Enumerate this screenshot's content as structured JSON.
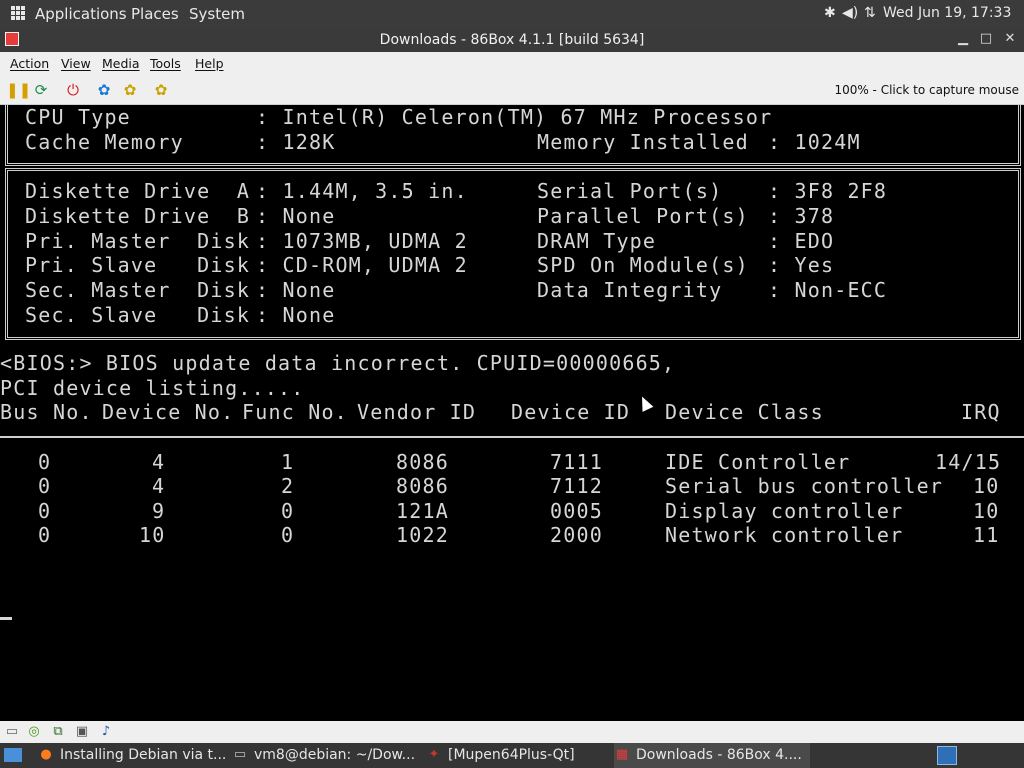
{
  "top_panel": {
    "menus": [
      "Applications",
      "Places",
      "System"
    ],
    "clock": "Wed Jun 19, 17:33",
    "tray_icons": [
      "bluetooth-icon",
      "volume-icon",
      "network-icon"
    ]
  },
  "window": {
    "title": "Downloads - 86Box 4.1.1 [build 5634]",
    "controls": [
      "minimize-icon",
      "maximize-icon",
      "close-icon"
    ]
  },
  "menubar": [
    "Action",
    "View",
    "Media",
    "Tools",
    "Help"
  ],
  "toolbar": {
    "icons": [
      "pause-icon",
      "reset-icon",
      "power-icon",
      "settings-icon",
      "ctrl-alt-del-icon",
      "hard-reset-icon"
    ],
    "capture_text": "100% - Click to capture mouse"
  },
  "bios": {
    "top_box": [
      {
        "left": "CPU Type",
        "left_val": ": Intel(R) Celeron(TM) 67 MHz Processor",
        "right": "",
        "right_val": ""
      },
      {
        "left": "Cache Memory",
        "left_val": ": 128K",
        "right": "Memory Installed",
        "right_val": ": 1024M"
      }
    ],
    "mid_box": [
      {
        "left": "Diskette Drive  A",
        "left_val": ": 1.44M, 3.5 in.",
        "right": "Serial Port(s)",
        "right_val": ": 3F8 2F8"
      },
      {
        "left": "Diskette Drive  B",
        "left_val": ": None",
        "right": "Parallel Port(s)",
        "right_val": ": 378"
      },
      {
        "left": "Pri. Master  Disk",
        "left_val": ": 1073MB, UDMA 2",
        "right": "DRAM Type",
        "right_val": ": EDO"
      },
      {
        "left": "Pri. Slave   Disk",
        "left_val": ": CD-ROM, UDMA 2",
        "right": "SPD On Module(s)",
        "right_val": ": Yes"
      },
      {
        "left": "Sec. Master  Disk",
        "left_val": ": None",
        "right": "Data Integrity",
        "right_val": ": Non-ECC"
      },
      {
        "left": "Sec. Slave   Disk",
        "left_val": ": None",
        "right": "",
        "right_val": ""
      }
    ],
    "message_line": "<BIOS:> BIOS update data incorrect. CPUID=00000665,",
    "pci_heading": "PCI device listing.....",
    "pci_columns": [
      "Bus No.",
      "Device No.",
      "Func No.",
      "Vendor ID",
      "Device ID",
      "Device Class",
      "IRQ"
    ],
    "pci_rows": [
      [
        "0",
        "4",
        "1",
        "8086",
        "7111",
        "IDE Controller",
        "14/15"
      ],
      [
        "0",
        "4",
        "2",
        "8086",
        "7112",
        "Serial bus controller",
        "10"
      ],
      [
        "0",
        "9",
        "0",
        "121A",
        "0005",
        "Display controller",
        "10"
      ],
      [
        "0",
        "10",
        "0",
        "1022",
        "2000",
        "Network controller",
        "11"
      ]
    ]
  },
  "statusbar": [
    "floppy-icon",
    "cdrom-icon",
    "network-adapter-icon",
    "hdd-icon",
    "sound-icon"
  ],
  "taskbar": [
    {
      "icon": "firefox-icon",
      "label": "Installing Debian via t..."
    },
    {
      "icon": "terminal-icon",
      "label": "vm8@debian: ~/Dow..."
    },
    {
      "icon": "mupen-icon",
      "label": "[Mupen64Plus-Qt]"
    },
    {
      "icon": "86box-icon",
      "label": "Downloads - 86Box 4...."
    }
  ]
}
